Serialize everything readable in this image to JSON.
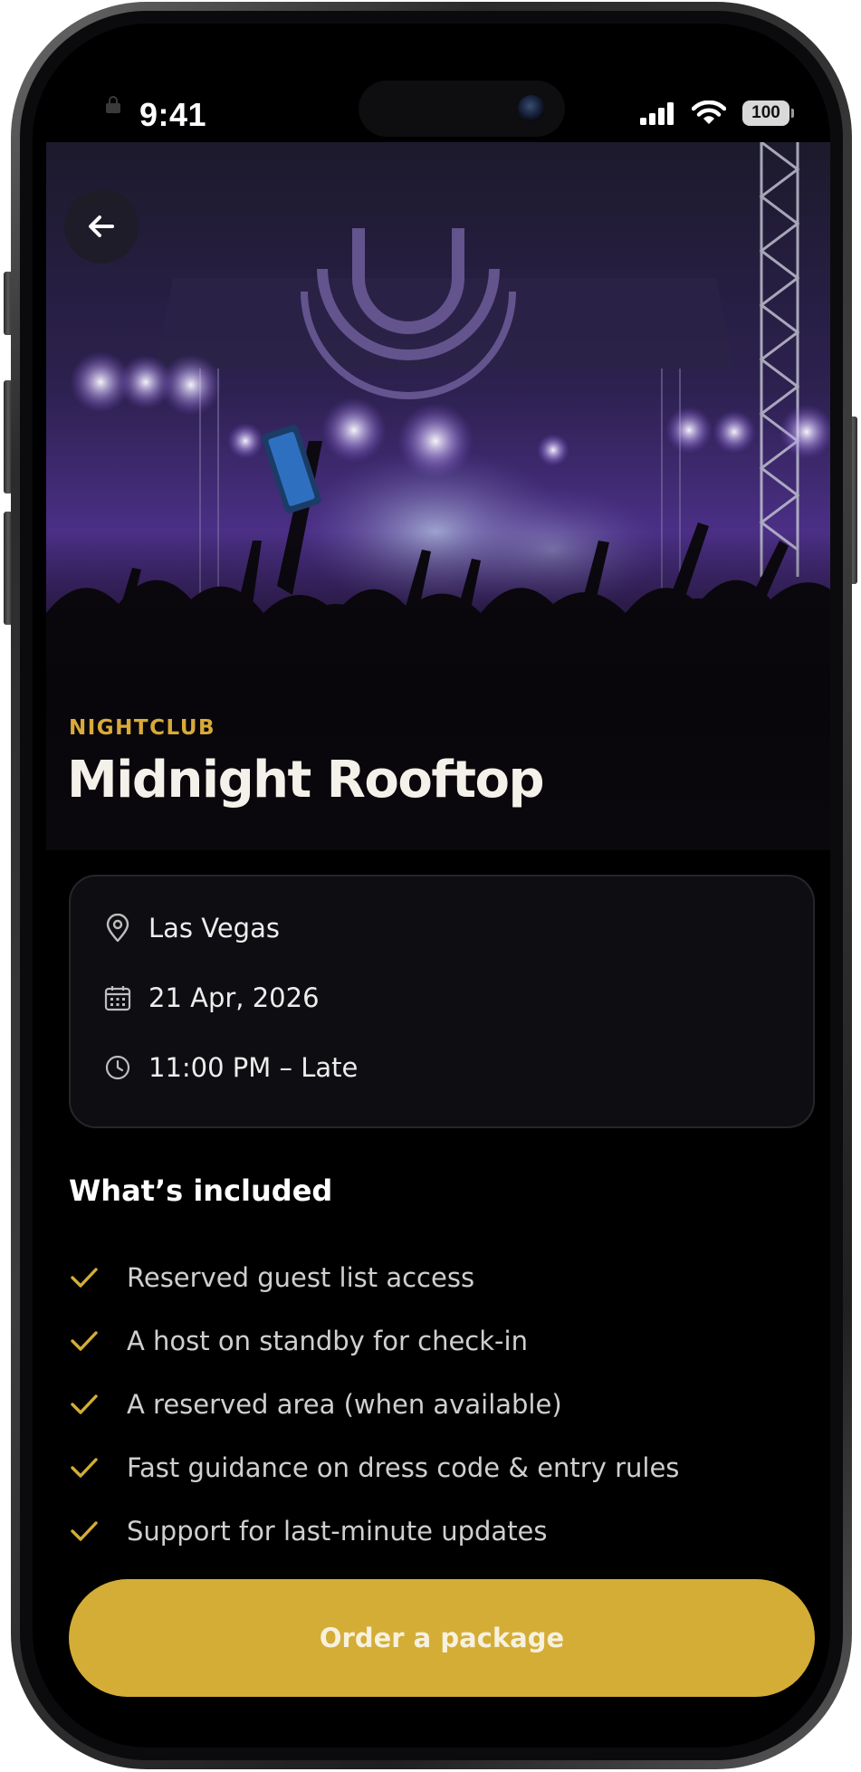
{
  "status_bar": {
    "time": "9:41",
    "battery": "100",
    "icons": [
      "lock-icon",
      "signal-icon",
      "wifi-icon",
      "battery-icon"
    ]
  },
  "hero": {
    "back_icon": "arrow-left-icon",
    "category": "NIGHTCLUB",
    "title": "Midnight Rooftop"
  },
  "details": [
    {
      "icon": "map-pin-icon",
      "text": "Las Vegas"
    },
    {
      "icon": "calendar-icon",
      "text": "21 Apr, 2026"
    },
    {
      "icon": "clock-icon",
      "text": "11:00 PM – Late"
    }
  ],
  "included": {
    "title": "What’s included",
    "items": [
      "Reserved guest list access",
      "A host on standby for check-in",
      "A reserved area (when available)",
      "Fast guidance on dress code & entry rules",
      "Support for last-minute updates"
    ]
  },
  "cta": {
    "label": "Order a package"
  },
  "colors": {
    "accent": "#d4ad37",
    "category": "#d9a93a",
    "background": "#000000",
    "card_border": "#25252b"
  }
}
